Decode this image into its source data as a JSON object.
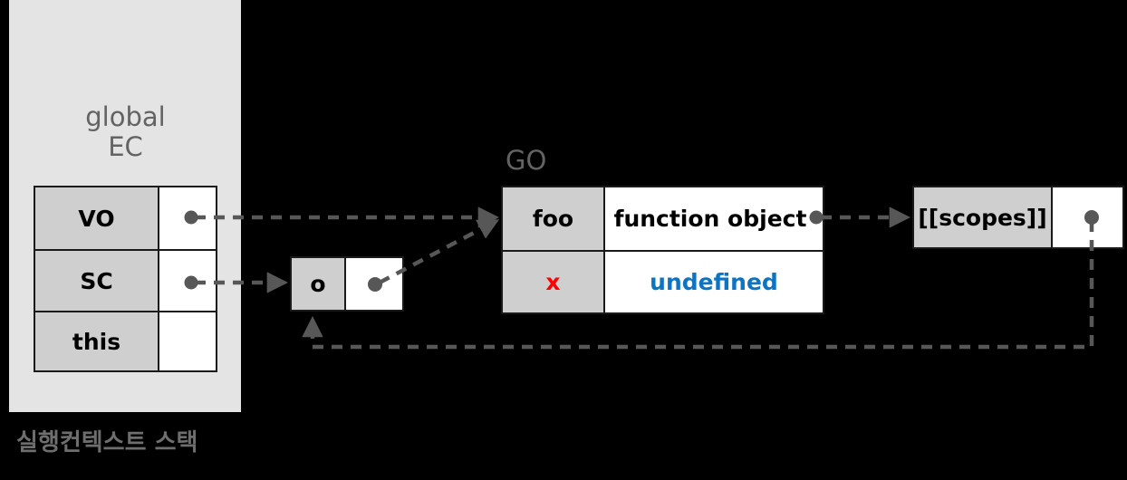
{
  "diagram": {
    "background_color": "#000000",
    "caption": "실행컨텍스트 스택",
    "stack_panel": {
      "label": "실행컨텍스트 스택",
      "panel_color": "#e4e4e4",
      "ec_title_line1": "global",
      "ec_title_line2": "EC",
      "ec_table": {
        "rows": [
          {
            "key": "VO",
            "value": ""
          },
          {
            "key": "SC",
            "value": ""
          },
          {
            "key": "this",
            "value": ""
          }
        ]
      }
    },
    "scope_chain_box": {
      "name": "o-object-box",
      "key": "o",
      "value": ""
    },
    "global_object": {
      "title": "GO",
      "rows": [
        {
          "key": "foo",
          "key_color": "#000000",
          "value": "function object",
          "value_color": "#000000"
        },
        {
          "key": "x",
          "key_color": "#ff0000",
          "value": "undefined",
          "value_color": "#0d74c4"
        }
      ]
    },
    "scopes_box": {
      "key": "[[scopes]]",
      "value": ""
    },
    "colors": {
      "panel": "#e4e4e4",
      "cell_key": "#cfcfcf",
      "cell_value": "#ffffff",
      "border": "#1a1a1a",
      "wire": "#575757",
      "title_text": "#636363",
      "caption_text": "#6e6e6e",
      "accent_red": "#ff0000",
      "accent_blue": "#0d74c4"
    }
  }
}
